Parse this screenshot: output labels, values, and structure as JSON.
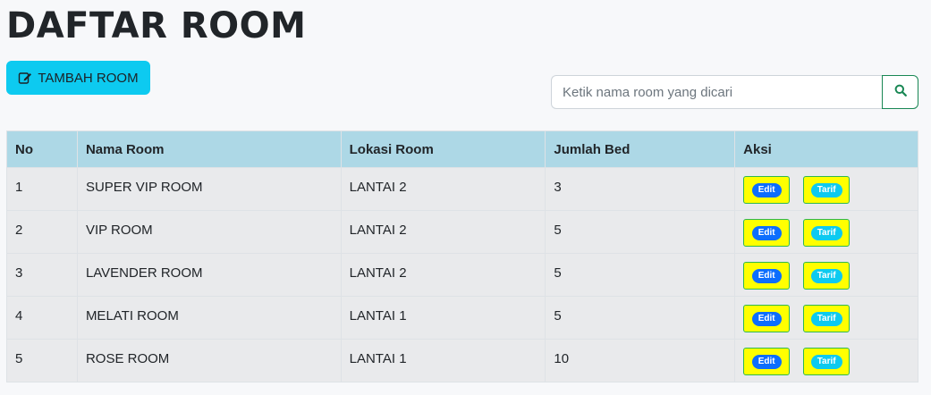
{
  "header": {
    "title": "DAFTAR ROOM"
  },
  "toolbar": {
    "add_label": "TAMBAH ROOM",
    "add_icon": "edit-icon"
  },
  "search": {
    "placeholder": "Ketik nama room yang dicari",
    "value": "",
    "button_icon": "search-icon"
  },
  "table": {
    "columns": [
      "No",
      "Nama Room",
      "Lokasi Room",
      "Jumlah Bed",
      "Aksi"
    ],
    "rows": [
      {
        "no": "1",
        "nama": "SUPER VIP ROOM",
        "lokasi": "LANTAI 2",
        "bed": "3"
      },
      {
        "no": "2",
        "nama": "VIP ROOM",
        "lokasi": "LANTAI 2",
        "bed": "5"
      },
      {
        "no": "3",
        "nama": "LAVENDER ROOM",
        "lokasi": "LANTAI 2",
        "bed": "5"
      },
      {
        "no": "4",
        "nama": "MELATI ROOM",
        "lokasi": "LANTAI 1",
        "bed": "5"
      },
      {
        "no": "5",
        "nama": "ROSE ROOM",
        "lokasi": "LANTAI 1",
        "bed": "10"
      }
    ],
    "actions": {
      "edit": "Edit",
      "tarif": "Tarif"
    }
  },
  "colors": {
    "add_button": "#0dcaf0",
    "header_row": "#add8e6",
    "action_button": "#ffff00",
    "edit_badge": "#0d6efd",
    "tarif_badge": "#0dcaf0",
    "search_button_border": "#198754"
  }
}
